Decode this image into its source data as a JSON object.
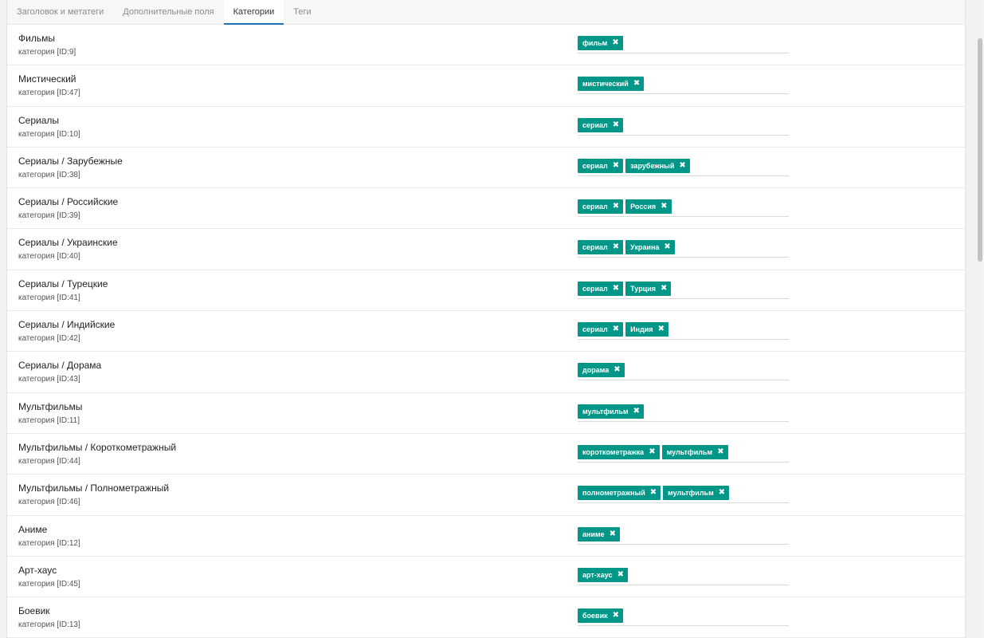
{
  "tabs": [
    {
      "label": "Заголовок и метатеги",
      "active": false
    },
    {
      "label": "Дополнительные поля",
      "active": false
    },
    {
      "label": "Категории",
      "active": true
    },
    {
      "label": "Теги",
      "active": false
    }
  ],
  "categories": [
    {
      "name": "Фильмы",
      "meta": "категория [ID:9]",
      "tags": [
        "фильм"
      ]
    },
    {
      "name": "Мистический",
      "meta": "категория [ID:47]",
      "tags": [
        "мистический"
      ]
    },
    {
      "name": "Сериалы",
      "meta": "категория [ID:10]",
      "tags": [
        "сериал"
      ]
    },
    {
      "name": "Сериалы / Зарубежные",
      "meta": "категория [ID:38]",
      "tags": [
        "сериал",
        "зарубежный"
      ]
    },
    {
      "name": "Сериалы / Российские",
      "meta": "категория [ID:39]",
      "tags": [
        "сериал",
        "Россия"
      ]
    },
    {
      "name": "Сериалы / Украинские",
      "meta": "категория [ID:40]",
      "tags": [
        "сериал",
        "Украина"
      ]
    },
    {
      "name": "Сериалы / Турецкие",
      "meta": "категория [ID:41]",
      "tags": [
        "сериал",
        "Турция"
      ]
    },
    {
      "name": "Сериалы / Индийские",
      "meta": "категория [ID:42]",
      "tags": [
        "сериал",
        "Индия"
      ]
    },
    {
      "name": "Сериалы / Дорама",
      "meta": "категория [ID:43]",
      "tags": [
        "дорама"
      ]
    },
    {
      "name": "Мультфильмы",
      "meta": "категория [ID:11]",
      "tags": [
        "мультфильм"
      ]
    },
    {
      "name": "Мультфильмы / Короткометражный",
      "meta": "категория [ID:44]",
      "tags": [
        "короткометражка",
        "мультфильм"
      ]
    },
    {
      "name": "Мультфильмы / Полнометражный",
      "meta": "категория [ID:46]",
      "tags": [
        "полнометражный",
        "мультфильм"
      ]
    },
    {
      "name": "Аниме",
      "meta": "категория [ID:12]",
      "tags": [
        "аниме"
      ]
    },
    {
      "name": "Арт-хаус",
      "meta": "категория [ID:45]",
      "tags": [
        "арт-хаус"
      ]
    },
    {
      "name": "Боевик",
      "meta": "категория [ID:13]",
      "tags": [
        "боевик"
      ]
    }
  ],
  "colors": {
    "tag_bg": "#009688",
    "active_tab_underline": "#1e73be"
  },
  "icons": {
    "tag_remove": "close-icon"
  }
}
